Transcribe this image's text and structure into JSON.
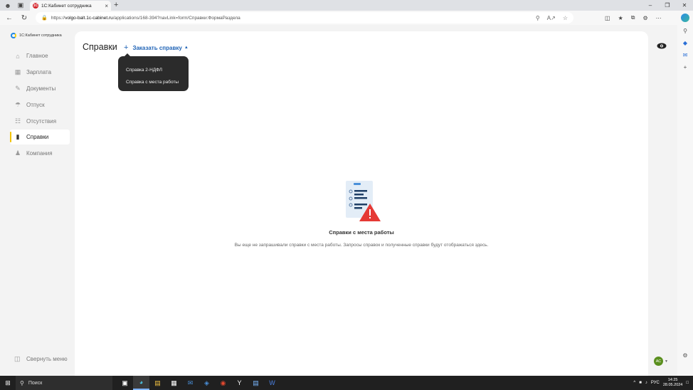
{
  "browser": {
    "tab_title": "1С:Кабинет сотрудника",
    "tab_close": "×",
    "new_tab": "+",
    "url_prefix": "https://",
    "url_host": "volgo-balt.1c-cabinet.ru",
    "url_path": "/applications/168-394?navLink=form/Справки:ФормаРаздела",
    "window_controls": [
      "–",
      "❐",
      "✕"
    ]
  },
  "sidebar": {
    "logo_text": "1С:Кабинет сотрудника",
    "items": [
      {
        "label": "Главное",
        "icon": "home-icon"
      },
      {
        "label": "Зарплата",
        "icon": "wallet-icon"
      },
      {
        "label": "Документы",
        "icon": "documents-icon"
      },
      {
        "label": "Отпуск",
        "icon": "vacation-icon"
      },
      {
        "label": "Отсутствия",
        "icon": "calendar-icon"
      },
      {
        "label": "Справки",
        "icon": "certificate-icon",
        "active": true
      },
      {
        "label": "Компания",
        "icon": "company-icon"
      }
    ],
    "collapse_label": "Свернуть меню"
  },
  "main": {
    "title": "Справки",
    "order_button": "Заказать справку",
    "dropdown": [
      "Справка 2-НДФЛ",
      "Справка с места работы"
    ],
    "empty_title": "Справки с места работы",
    "empty_text": "Вы еще не запрашивали справки с места работы. Запросы справок и полученные справки будут отображаться здесь.",
    "user_initials": "АС"
  },
  "taskbar": {
    "search_placeholder": "Поиск",
    "language": "РУС",
    "time": "14:25",
    "date": "28.05.2024"
  },
  "colors": {
    "accent": "#1f63b6",
    "active_marker": "#f2c200",
    "avatar": "#5a8f1e",
    "warning": "#e53935"
  }
}
